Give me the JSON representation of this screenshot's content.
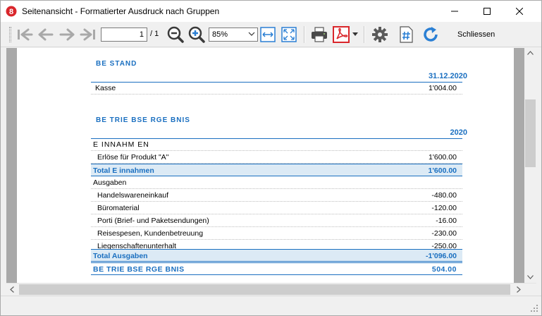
{
  "window": {
    "title": "Seitenansicht - Formatierter Ausdruck nach Gruppen"
  },
  "toolbar": {
    "page_value": "1",
    "page_total": "/ 1",
    "zoom_value": "85%",
    "close_label": "Schliessen"
  },
  "report": {
    "bestand": {
      "title": "BE STAND",
      "date_header": "31.12.2020",
      "rows": [
        {
          "label": "Kasse",
          "value": "1'004.00"
        }
      ]
    },
    "betriebsergebnis": {
      "title": "BE TRIE BSE RGE BNIS",
      "year_header": "2020",
      "einnahmen_group": "E INNAHM EN",
      "einnahmen_rows": [
        {
          "label": "Erlöse für Produkt \"A\"",
          "value": "1'600.00"
        }
      ],
      "einnahmen_total": {
        "label": "Total E innahmen",
        "value": "1'600.00"
      },
      "ausgaben_group": "Ausgaben",
      "ausgaben_rows": [
        {
          "label": "Handelswareneinkauf",
          "value": "-480.00"
        },
        {
          "label": "Büromaterial",
          "value": "-120.00"
        },
        {
          "label": "Porti (Brief- und Paketsendungen)",
          "value": "-16.00"
        },
        {
          "label": "Reisespesen, Kundenbetreuung",
          "value": "-230.00"
        },
        {
          "label": "Liegenschaftenunterhalt",
          "value": "-250.00"
        }
      ],
      "ausgaben_total": {
        "label": "Total Ausgaben",
        "value": "-1'096.00"
      },
      "result": {
        "label": "BE TRIE BSE RGE BNIS",
        "value": "504.00"
      }
    }
  },
  "colors": {
    "accent_blue": "#1a6fc0",
    "total_row_bg": "#dceaf5",
    "pdf_red": "#d9262b",
    "icon_blue": "#2a7fd4"
  }
}
